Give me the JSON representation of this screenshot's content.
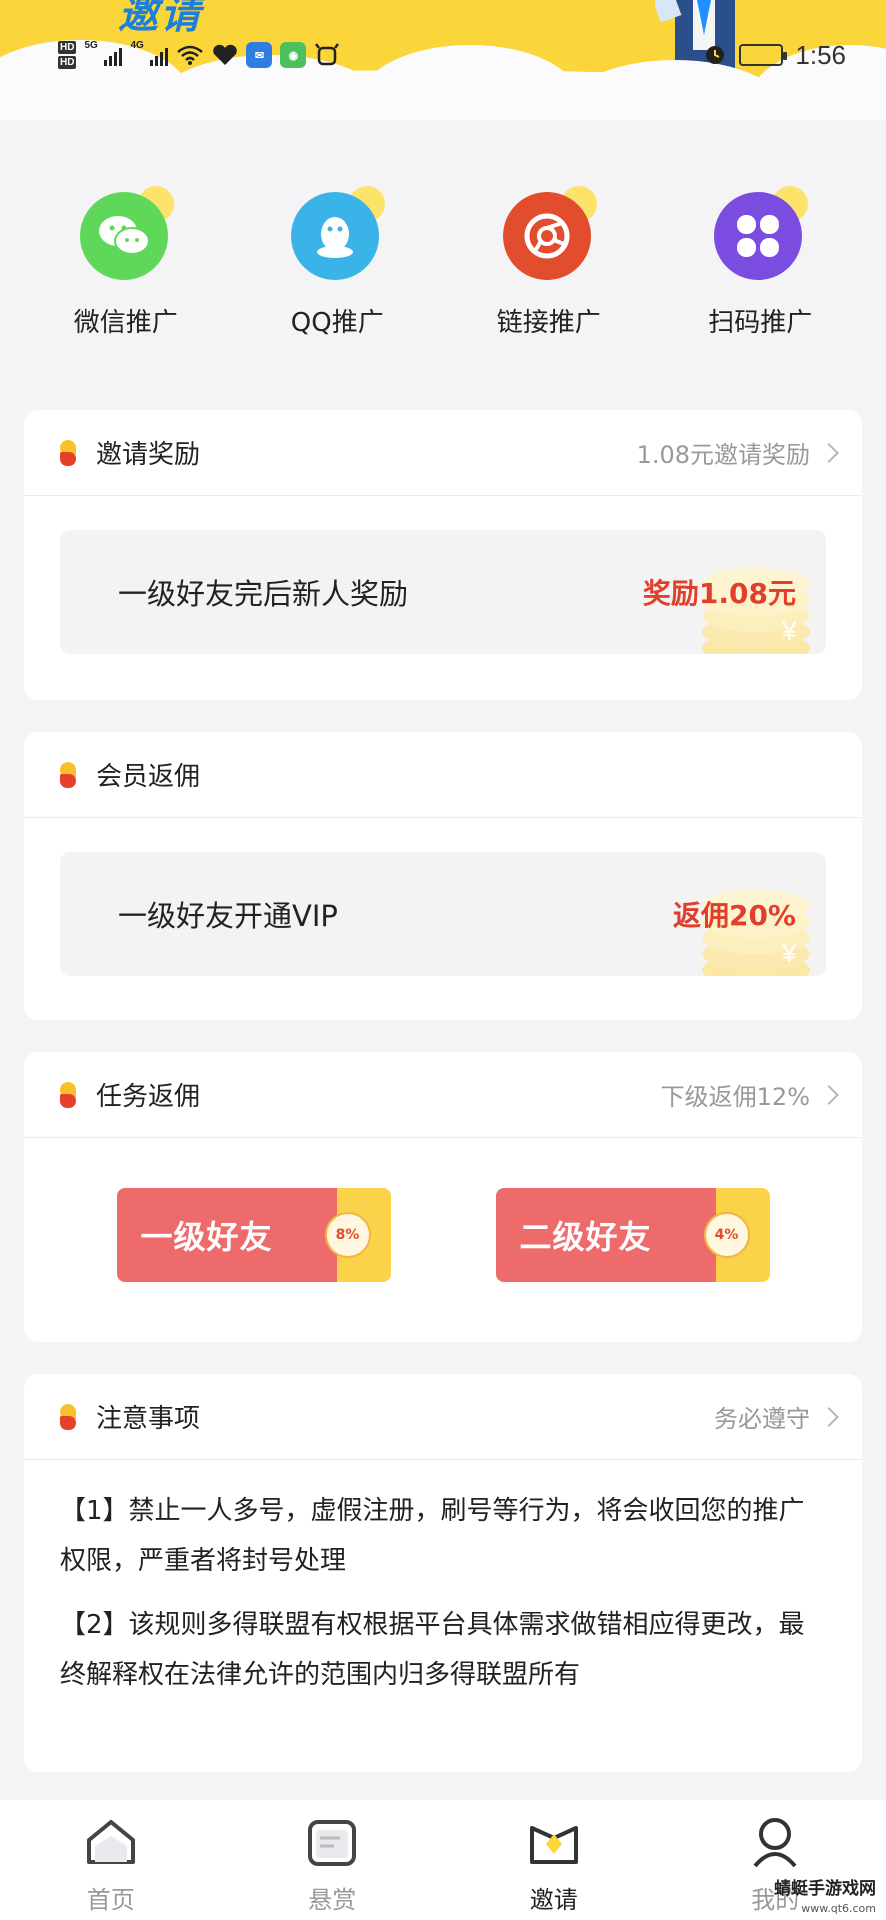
{
  "status_bar": {
    "time": "1:56",
    "network": [
      "5G",
      "4G"
    ],
    "hd_badges": [
      "HD",
      "HD"
    ]
  },
  "banner": {
    "title_fragment": "邀请"
  },
  "share": {
    "items": [
      {
        "label": "微信推广",
        "icon": "wechat-icon",
        "color": "#5fd85a"
      },
      {
        "label": "QQ推广",
        "icon": "qq-icon",
        "color": "#3ab4e8"
      },
      {
        "label": "链接推广",
        "icon": "link-icon",
        "color": "#e24d2e"
      },
      {
        "label": "扫码推广",
        "icon": "qr-scan-icon",
        "color": "#7b4ce0"
      }
    ]
  },
  "invite_reward": {
    "title": "邀请奖励",
    "side": "1.08元邀请奖励",
    "row_text": "一级好友完后新人奖励",
    "row_value": "奖励1.08元"
  },
  "member_commission": {
    "title": "会员返佣",
    "row_text": "一级好友开通VIP",
    "row_value": "返佣20%"
  },
  "task_commission": {
    "title": "任务返佣",
    "side": "下级返佣12%",
    "tickets": [
      {
        "label": "一级好友",
        "rate": "8%"
      },
      {
        "label": "二级好友",
        "rate": "4%"
      }
    ]
  },
  "notes": {
    "title": "注意事项",
    "side": "务必遵守",
    "items": [
      "【1】禁止一人多号，虚假注册，刷号等行为，将会收回您的推广权限，严重者将封号处理",
      "【2】该规则多得联盟有权根据平台具体需求做错相应得更改，最终解释权在法律允许的范围内归多得联盟所有"
    ]
  },
  "tabbar": {
    "items": [
      {
        "label": "首页",
        "icon": "home-icon",
        "active": false
      },
      {
        "label": "悬赏",
        "icon": "reward-doc-icon",
        "active": false
      },
      {
        "label": "邀请",
        "icon": "invite-icon",
        "active": true
      },
      {
        "label": "我的",
        "icon": "profile-icon",
        "active": false
      }
    ]
  },
  "watermark": {
    "name": "蜻蜓手游戏网",
    "url": "www.qt6.com"
  },
  "colors": {
    "accent_yellow": "#fbd63a",
    "accent_red": "#e23e2a",
    "background": "#f4f4f7"
  }
}
